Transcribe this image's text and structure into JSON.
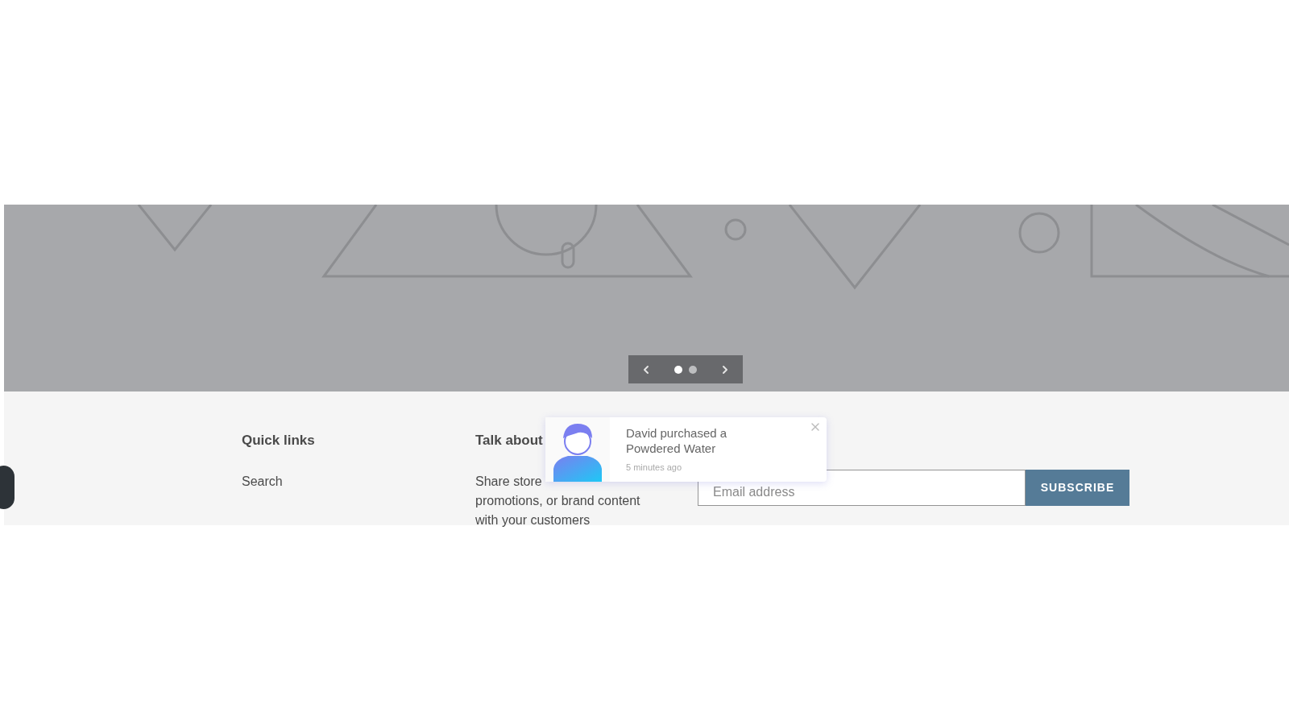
{
  "carousel": {
    "dots": [
      {
        "selected": true
      },
      {
        "selected": false
      }
    ]
  },
  "footer": {
    "columns": [
      {
        "heading": "Quick links",
        "links": [
          "Search"
        ]
      },
      {
        "heading": "Talk about",
        "lines": [
          "Share store",
          "promotions, or brand content",
          "with your customers"
        ]
      }
    ],
    "newsletter": {
      "placeholder": "Email address",
      "button": "SUBSCRIBE"
    }
  },
  "notification": {
    "message": "David purchased a Powdered Water",
    "time": "5 minutes ago"
  }
}
